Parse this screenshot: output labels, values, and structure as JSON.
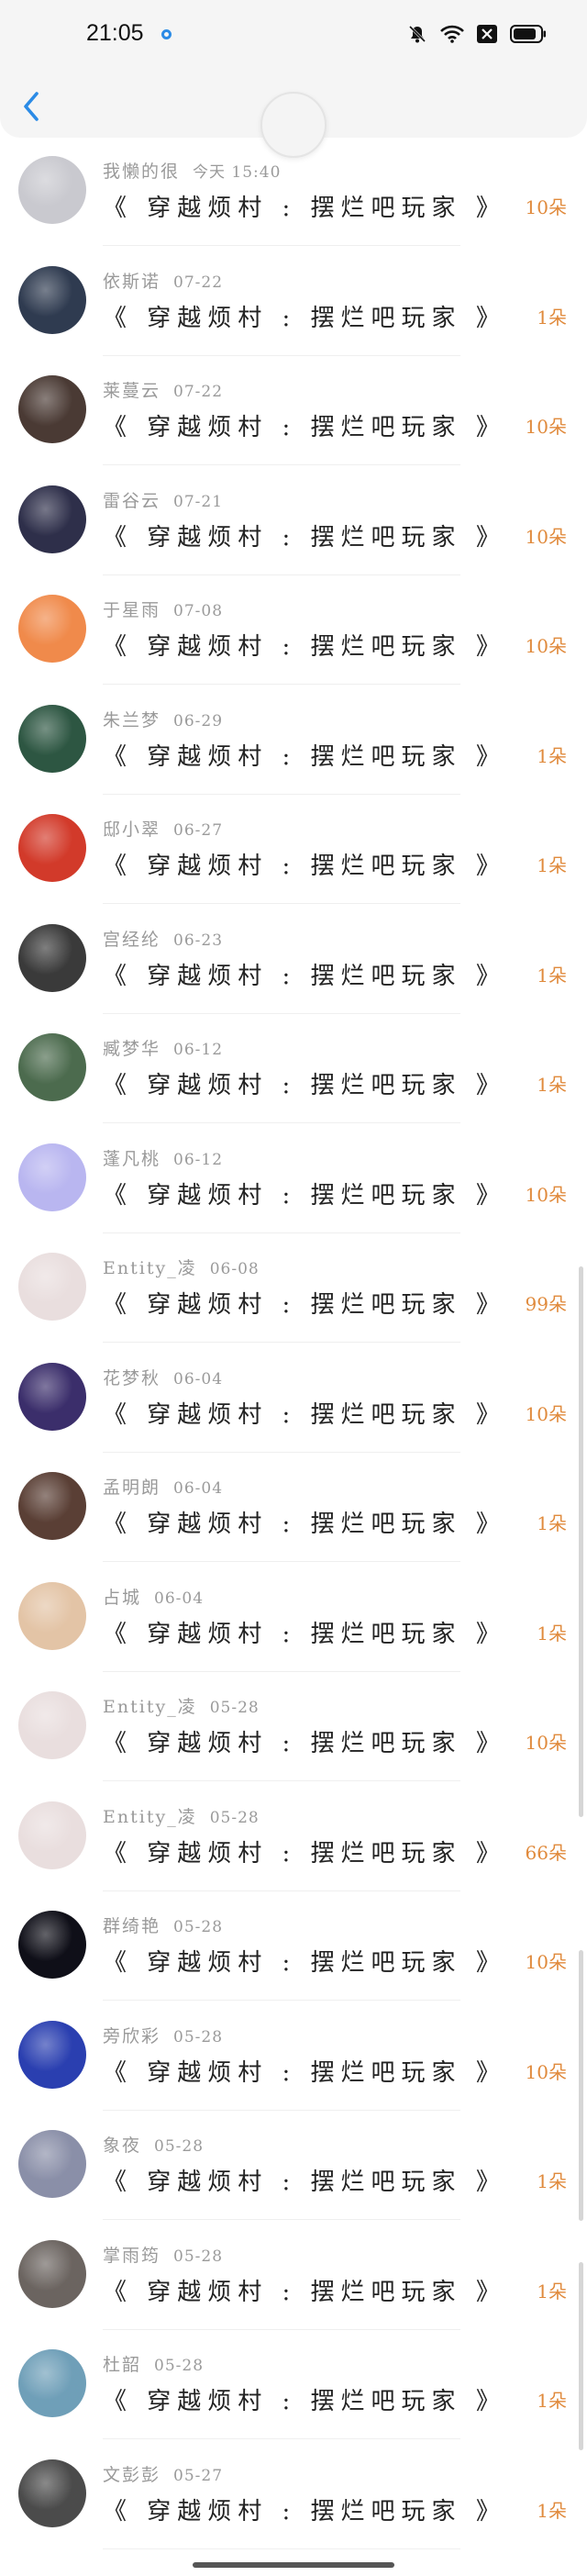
{
  "status_bar": {
    "time": "21:05",
    "icons": [
      "search-dot-icon",
      "mute-bell-icon",
      "wifi-icon",
      "close-box-icon",
      "battery-icon"
    ]
  },
  "header": {
    "back_icon": "chevron-left-icon",
    "accent_color": "#2b8be6"
  },
  "colors": {
    "amount": "#e08a3c",
    "name": "#9a9a9a",
    "title": "#222222"
  },
  "records": [
    {
      "name": "我懒的很",
      "date": "今天 15:40",
      "title": "《 穿越烦村 : 摆烂吧玩家 》",
      "amount": "10朵",
      "avatar_color": "#c9c9cf"
    },
    {
      "name": "依斯诺",
      "date": "07-22",
      "title": "《 穿越烦村 : 摆烂吧玩家 》",
      "amount": "1朵",
      "avatar_color": "#2f3b50"
    },
    {
      "name": "莱蔓云",
      "date": "07-22",
      "title": "《 穿越烦村 : 摆烂吧玩家 》",
      "amount": "10朵",
      "avatar_color": "#4a3a34"
    },
    {
      "name": "雷谷云",
      "date": "07-21",
      "title": "《 穿越烦村 : 摆烂吧玩家 》",
      "amount": "10朵",
      "avatar_color": "#2e2f4a"
    },
    {
      "name": "于星雨",
      "date": "07-08",
      "title": "《 穿越烦村 : 摆烂吧玩家 》",
      "amount": "10朵",
      "avatar_color": "#f08a4b"
    },
    {
      "name": "朱兰梦",
      "date": "06-29",
      "title": "《 穿越烦村 : 摆烂吧玩家 》",
      "amount": "1朵",
      "avatar_color": "#2d5642"
    },
    {
      "name": "邸小翠",
      "date": "06-27",
      "title": "《 穿越烦村 : 摆烂吧玩家 》",
      "amount": "1朵",
      "avatar_color": "#d23a2a"
    },
    {
      "name": "宫经纶",
      "date": "06-23",
      "title": "《 穿越烦村 : 摆烂吧玩家 》",
      "amount": "1朵",
      "avatar_color": "#3a3a3a"
    },
    {
      "name": "臧梦华",
      "date": "06-12",
      "title": "《 穿越烦村 : 摆烂吧玩家 》",
      "amount": "1朵",
      "avatar_color": "#4c6b4e"
    },
    {
      "name": "蓬凡桃",
      "date": "06-12",
      "title": "《 穿越烦村 : 摆烂吧玩家 》",
      "amount": "10朵",
      "avatar_color": "#b9b6f0"
    },
    {
      "name": "Entity_凌",
      "date": "06-08",
      "title": "《 穿越烦村 : 摆烂吧玩家 》",
      "amount": "99朵",
      "avatar_color": "#e9dede"
    },
    {
      "name": "花梦秋",
      "date": "06-04",
      "title": "《 穿越烦村 : 摆烂吧玩家 》",
      "amount": "10朵",
      "avatar_color": "#3b2e6b"
    },
    {
      "name": "孟明朗",
      "date": "06-04",
      "title": "《 穿越烦村 : 摆烂吧玩家 》",
      "amount": "1朵",
      "avatar_color": "#5a3f35"
    },
    {
      "name": "占城",
      "date": "06-04",
      "title": "《 穿越烦村 : 摆烂吧玩家 》",
      "amount": "1朵",
      "avatar_color": "#e3c4a6"
    },
    {
      "name": "Entity_凌",
      "date": "05-28",
      "title": "《 穿越烦村 : 摆烂吧玩家 》",
      "amount": "10朵",
      "avatar_color": "#e9dede"
    },
    {
      "name": "Entity_凌",
      "date": "05-28",
      "title": "《 穿越烦村 : 摆烂吧玩家 》",
      "amount": "66朵",
      "avatar_color": "#e9dede"
    },
    {
      "name": "群绮艳",
      "date": "05-28",
      "title": "《 穿越烦村 : 摆烂吧玩家 》",
      "amount": "10朵",
      "avatar_color": "#0f0f18"
    },
    {
      "name": "旁欣彩",
      "date": "05-28",
      "title": "《 穿越烦村 : 摆烂吧玩家 》",
      "amount": "10朵",
      "avatar_color": "#2a3fb0"
    },
    {
      "name": "象夜",
      "date": "05-28",
      "title": "《 穿越烦村 : 摆烂吧玩家 》",
      "amount": "1朵",
      "avatar_color": "#8a8fa8"
    },
    {
      "name": "掌雨筠",
      "date": "05-28",
      "title": "《 穿越烦村 : 摆烂吧玩家 》",
      "amount": "1朵",
      "avatar_color": "#6b6460"
    },
    {
      "name": "杜韶",
      "date": "05-28",
      "title": "《 穿越烦村 : 摆烂吧玩家 》",
      "amount": "1朵",
      "avatar_color": "#6f9fb8"
    },
    {
      "name": "文彭彭",
      "date": "05-27",
      "title": "《 穿越烦村 : 摆烂吧玩家 》",
      "amount": "1朵",
      "avatar_color": "#4b4b4b"
    }
  ]
}
